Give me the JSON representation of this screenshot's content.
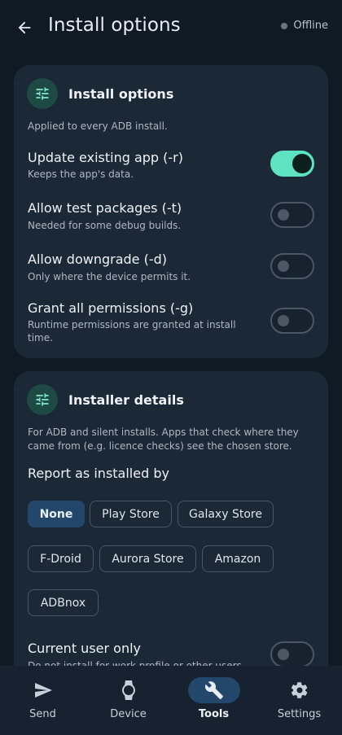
{
  "header": {
    "title": "Install options",
    "status": "Offline",
    "back_icon": "arrow-left-icon"
  },
  "install_options_card": {
    "title": "Install options",
    "icon": "tune-icon",
    "description": "Applied to every ADB install.",
    "options": [
      {
        "label": "Update existing app (-r)",
        "sublabel": "Keeps the app's data.",
        "enabled": true
      },
      {
        "label": "Allow test packages (-t)",
        "sublabel": "Needed for some debug builds.",
        "enabled": false
      },
      {
        "label": "Allow downgrade (-d)",
        "sublabel": "Only where the device permits it.",
        "enabled": false
      },
      {
        "label": "Grant all permissions (-g)",
        "sublabel": "Runtime permissions are granted at install time.",
        "enabled": false
      }
    ]
  },
  "installer_card": {
    "title": "Installer details",
    "icon": "tune-icon",
    "description": "For ADB and silent installs. Apps that check where they came from (e.g. licence checks) see the chosen store.",
    "report_label": "Report as installed by",
    "chips": [
      "None",
      "Play Store",
      "Galaxy Store",
      "F-Droid",
      "Aurora Store",
      "Amazon",
      "ADBnox"
    ],
    "selected_chip": "None",
    "current_user": {
      "label": "Current user only",
      "sublabel": "Do not install for work profile or other users",
      "enabled": false
    }
  },
  "bottom_nav": {
    "items": [
      {
        "label": "Send",
        "icon": "send-icon"
      },
      {
        "label": "Device",
        "icon": "watch-icon"
      },
      {
        "label": "Tools",
        "icon": "wrench-icon"
      },
      {
        "label": "Settings",
        "icon": "gear-icon"
      }
    ],
    "active": "Tools"
  },
  "colors": {
    "background": "#0f1a24",
    "card": "#1b2836",
    "accent": "#5ee3c0",
    "selected": "#23476a"
  }
}
